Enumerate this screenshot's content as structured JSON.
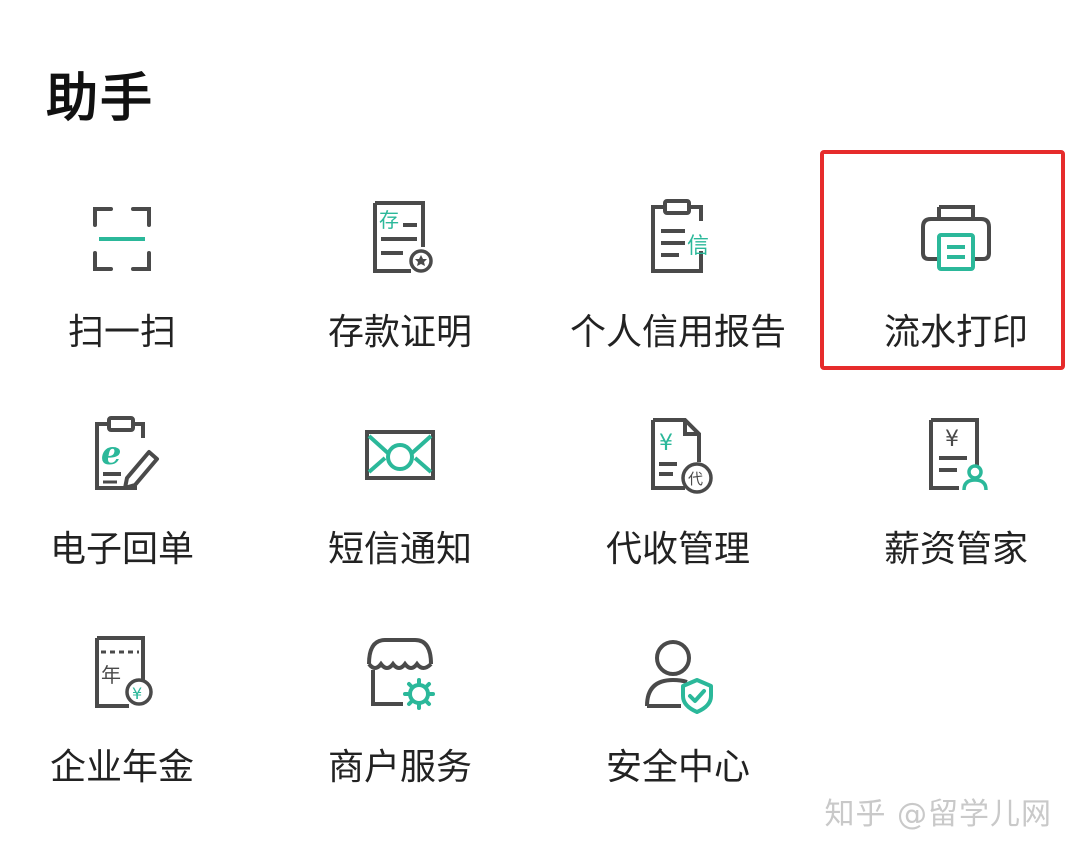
{
  "header": {
    "title": "助手"
  },
  "colors": {
    "accent": "#2bb89a",
    "icon_stroke": "#4a4a4a",
    "highlight": "#e62b2b"
  },
  "items": [
    {
      "label": "扫一扫",
      "icon": "scan-icon"
    },
    {
      "label": "存款证明",
      "icon": "deposit-certificate-icon",
      "icon_text": "存"
    },
    {
      "label": "个人信用报告",
      "icon": "credit-report-icon",
      "icon_text": "信"
    },
    {
      "label": "流水打印",
      "icon": "printer-icon",
      "highlighted": true
    },
    {
      "label": "电子回单",
      "icon": "e-receipt-icon",
      "icon_text": "e"
    },
    {
      "label": "短信通知",
      "icon": "sms-envelope-icon"
    },
    {
      "label": "代收管理",
      "icon": "collection-management-icon",
      "icon_text": "¥",
      "badge_text": "代"
    },
    {
      "label": "薪资管家",
      "icon": "salary-manager-icon",
      "icon_text": "¥"
    },
    {
      "label": "企业年金",
      "icon": "enterprise-annuity-icon",
      "icon_text": "年",
      "badge_text": "¥"
    },
    {
      "label": "商户服务",
      "icon": "merchant-service-icon"
    },
    {
      "label": "安全中心",
      "icon": "security-center-icon"
    }
  ],
  "watermark": "知乎 @留学儿网"
}
